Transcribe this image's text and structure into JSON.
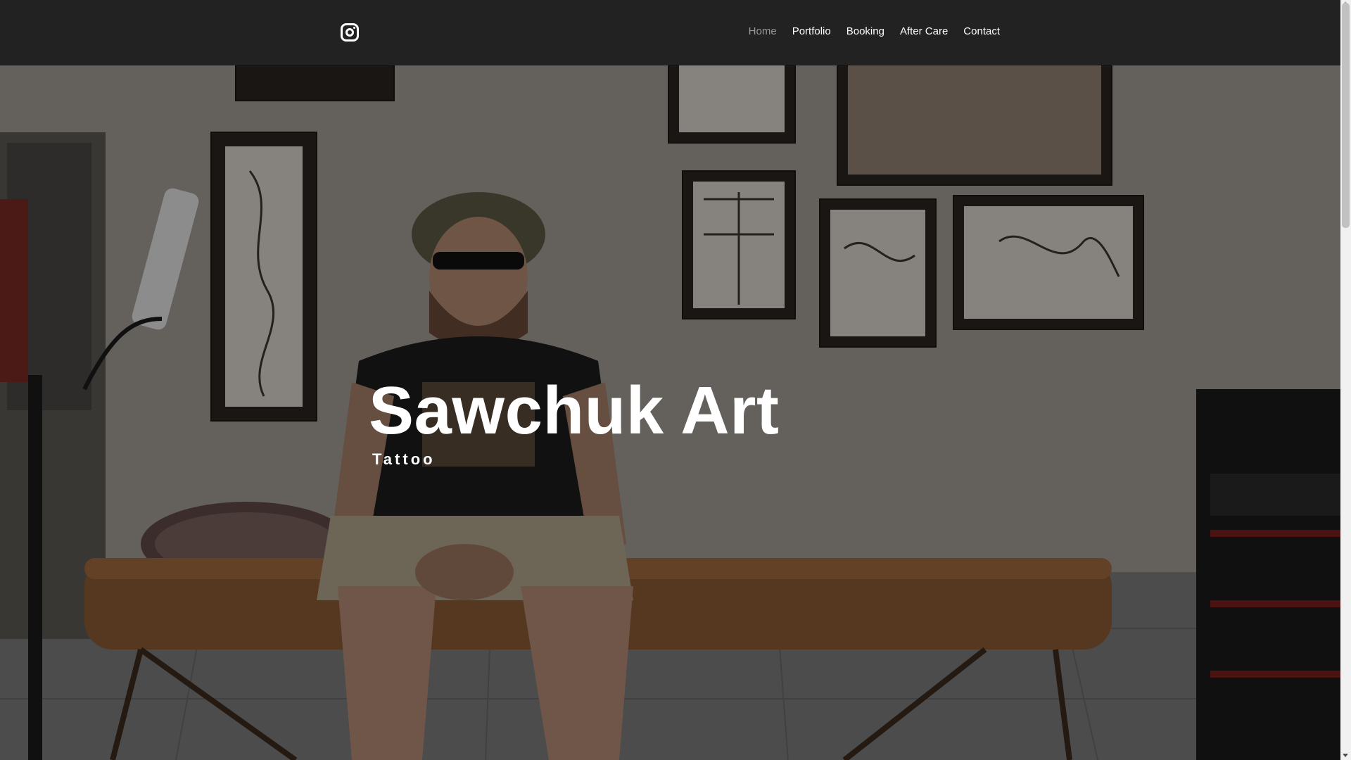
{
  "header": {
    "social_icon": "instagram-icon",
    "nav": [
      {
        "label": "Home",
        "active": true
      },
      {
        "label": "Portfolio",
        "active": false
      },
      {
        "label": "Booking",
        "active": false
      },
      {
        "label": "After Care",
        "active": false
      },
      {
        "label": "Contact",
        "active": false
      }
    ]
  },
  "hero": {
    "title": "Sawchuk Art",
    "subtitle": "Tattoo",
    "background": "tattoo-artist-studio-photo"
  },
  "colors": {
    "header_bg": "#222222",
    "nav_text": "#ffffff",
    "nav_active": "#9a9a9a",
    "hero_text": "#ffffff"
  }
}
